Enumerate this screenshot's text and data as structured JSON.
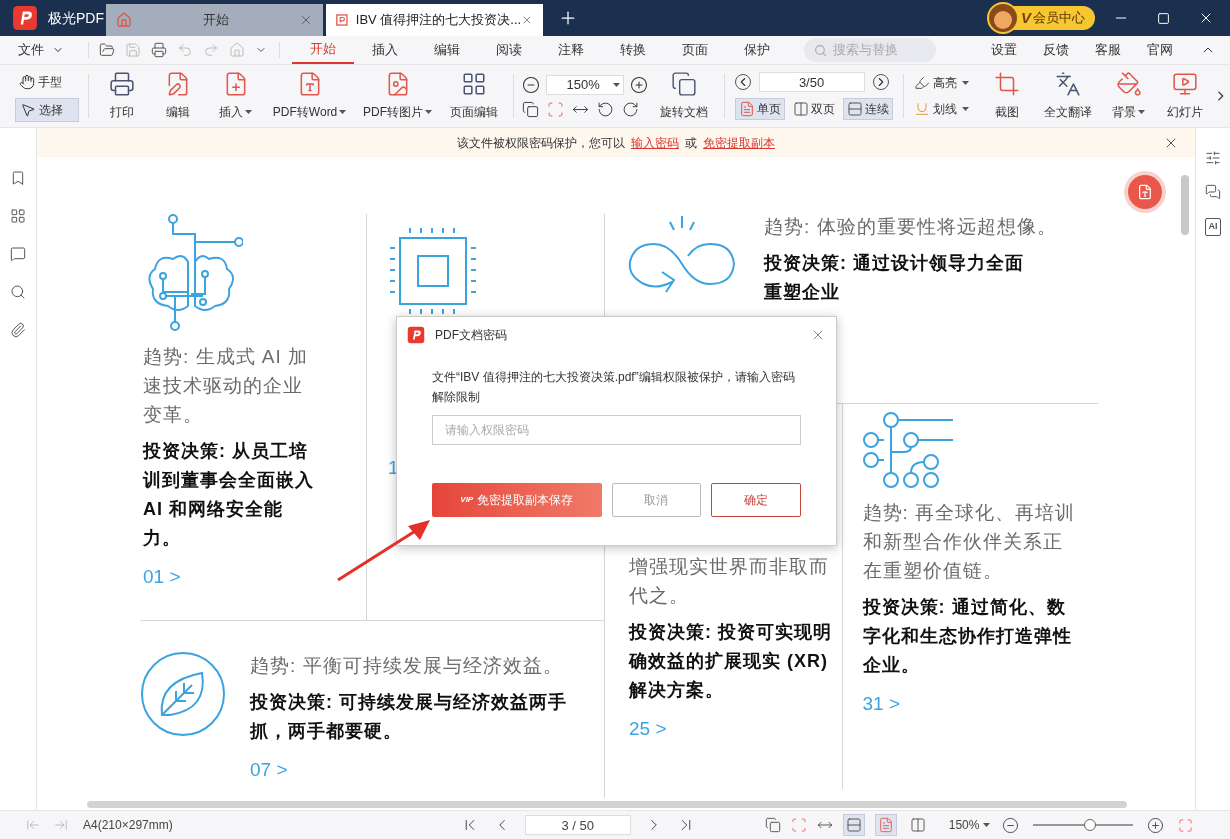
{
  "app": {
    "name": "极光PDF"
  },
  "tabs": [
    {
      "label": "开始",
      "kind": "home",
      "selected": false
    },
    {
      "label": "IBV 值得押注的七大投资决...",
      "kind": "doc",
      "selected": true
    }
  ],
  "vip": {
    "label": "会员中心",
    "tag": "V"
  },
  "menu": {
    "file": "文件",
    "items": [
      {
        "label": "开始",
        "selected": true
      },
      {
        "label": "插入",
        "selected": false
      },
      {
        "label": "编辑",
        "selected": false
      },
      {
        "label": "阅读",
        "selected": false
      },
      {
        "label": "注释",
        "selected": false
      },
      {
        "label": "转换",
        "selected": false
      },
      {
        "label": "页面",
        "selected": false
      },
      {
        "label": "保护",
        "selected": false
      }
    ],
    "search": {
      "placeholder": "搜索与替换"
    },
    "right": [
      "设置",
      "反馈",
      "客服",
      "官网"
    ]
  },
  "toolbar": {
    "modes": [
      {
        "label": "手型",
        "kind": "hand",
        "selected": false
      },
      {
        "label": "选择",
        "kind": "select",
        "selected": true
      }
    ],
    "tools": [
      {
        "label": "打印",
        "kind": "print",
        "dropdown": false
      },
      {
        "label": "编辑",
        "kind": "edit",
        "dropdown": false
      },
      {
        "label": "插入",
        "kind": "insert",
        "dropdown": true
      },
      {
        "label": "PDF转Word",
        "kind": "word",
        "dropdown": true
      },
      {
        "label": "PDF转图片",
        "kind": "image",
        "dropdown": true
      },
      {
        "label": "页面编辑",
        "kind": "pages",
        "dropdown": false
      }
    ],
    "zoom": "150%",
    "rotate": "旋转文档",
    "page": "3/50",
    "views": [
      {
        "label": "单页",
        "kind": "single",
        "selected": true
      },
      {
        "label": "双页",
        "kind": "double",
        "selected": false
      },
      {
        "label": "连续",
        "kind": "continuous",
        "selected": true
      }
    ],
    "marks": [
      {
        "label": "高亮",
        "kind": "highlight"
      },
      {
        "label": "划线",
        "kind": "underline"
      }
    ],
    "extras": [
      {
        "label": "截图",
        "kind": "screenshot",
        "dropdown": false
      },
      {
        "label": "全文翻译",
        "kind": "translate",
        "dropdown": false
      },
      {
        "label": "背景",
        "kind": "background",
        "dropdown": true
      },
      {
        "label": "幻灯片",
        "kind": "slides",
        "dropdown": false
      }
    ]
  },
  "notice": {
    "text": "该文件被权限密码保护，您可以",
    "link1": "输入密码",
    "sep": "或",
    "link2": "免密提取副本"
  },
  "cards": [
    {
      "kind": "brain",
      "trend": "趋势: 生成式 AI 加速技术驱动的企业变革。",
      "decision": "投资决策: 从员工培训到董事会全面嵌入 AI 和网络安全能力。",
      "number": "01 >"
    },
    {
      "kind": "chip",
      "number": "1"
    },
    {
      "kind": "infinity",
      "trend": "趋势: 体验的重要性将远超想像。",
      "decision": "投资决策: 通过设计领导力全面重塑企业"
    },
    {
      "kind": "blank",
      "trend": "增强现实世界而非取而代之。",
      "decision": "投资决策: 投资可实现明确效益的扩展现实 (XR) 解决方案。",
      "number": "25 >"
    },
    {
      "kind": "network",
      "trend": "趋势: 再全球化、再培训和新型合作伙伴关系正在重塑价值链。",
      "decision": "投资决策: 通过简化、数字化和生态协作打造弹性企业。",
      "number": "31 >"
    },
    {
      "kind": "leaf",
      "trend": "趋势: 平衡可持续发展与经济效益。",
      "decision": "投资决策: 可持续发展与经济效益两手抓，两手都要硬。",
      "number": "07 >"
    }
  ],
  "dialog": {
    "title": "PDF文档密码",
    "message": "文件“IBV 值得押注的七大投资决策.pdf”编辑权限被保护，请输入密码解除限制",
    "placeholder": "请输入权限密码",
    "buttons": [
      {
        "label": "免密提取副本保存",
        "kind": "vip",
        "tag": "VIP"
      },
      {
        "label": "取消",
        "kind": "cancel"
      },
      {
        "label": "确定",
        "kind": "ok"
      }
    ]
  },
  "right_panel": {
    "ai": "AI"
  },
  "status": {
    "paper": "A4(210×297mm)",
    "page": "3 / 50",
    "views": [
      {
        "selected": true
      },
      {
        "selected": true
      },
      {
        "selected": false
      }
    ],
    "zoom": "150%",
    "level": 0.57
  }
}
